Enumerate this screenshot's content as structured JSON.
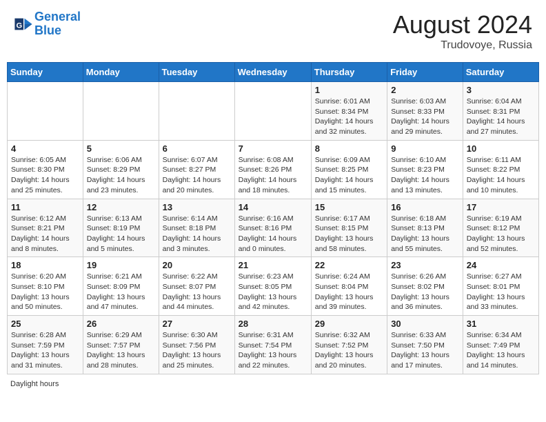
{
  "header": {
    "logo_line1": "General",
    "logo_line2": "Blue",
    "month": "August 2024",
    "location": "Trudovoye, Russia"
  },
  "days_of_week": [
    "Sunday",
    "Monday",
    "Tuesday",
    "Wednesday",
    "Thursday",
    "Friday",
    "Saturday"
  ],
  "weeks": [
    [
      {
        "day": "",
        "info": ""
      },
      {
        "day": "",
        "info": ""
      },
      {
        "day": "",
        "info": ""
      },
      {
        "day": "",
        "info": ""
      },
      {
        "day": "1",
        "info": "Sunrise: 6:01 AM\nSunset: 8:34 PM\nDaylight: 14 hours and 32 minutes."
      },
      {
        "day": "2",
        "info": "Sunrise: 6:03 AM\nSunset: 8:33 PM\nDaylight: 14 hours and 29 minutes."
      },
      {
        "day": "3",
        "info": "Sunrise: 6:04 AM\nSunset: 8:31 PM\nDaylight: 14 hours and 27 minutes."
      }
    ],
    [
      {
        "day": "4",
        "info": "Sunrise: 6:05 AM\nSunset: 8:30 PM\nDaylight: 14 hours and 25 minutes."
      },
      {
        "day": "5",
        "info": "Sunrise: 6:06 AM\nSunset: 8:29 PM\nDaylight: 14 hours and 23 minutes."
      },
      {
        "day": "6",
        "info": "Sunrise: 6:07 AM\nSunset: 8:27 PM\nDaylight: 14 hours and 20 minutes."
      },
      {
        "day": "7",
        "info": "Sunrise: 6:08 AM\nSunset: 8:26 PM\nDaylight: 14 hours and 18 minutes."
      },
      {
        "day": "8",
        "info": "Sunrise: 6:09 AM\nSunset: 8:25 PM\nDaylight: 14 hours and 15 minutes."
      },
      {
        "day": "9",
        "info": "Sunrise: 6:10 AM\nSunset: 8:23 PM\nDaylight: 14 hours and 13 minutes."
      },
      {
        "day": "10",
        "info": "Sunrise: 6:11 AM\nSunset: 8:22 PM\nDaylight: 14 hours and 10 minutes."
      }
    ],
    [
      {
        "day": "11",
        "info": "Sunrise: 6:12 AM\nSunset: 8:21 PM\nDaylight: 14 hours and 8 minutes."
      },
      {
        "day": "12",
        "info": "Sunrise: 6:13 AM\nSunset: 8:19 PM\nDaylight: 14 hours and 5 minutes."
      },
      {
        "day": "13",
        "info": "Sunrise: 6:14 AM\nSunset: 8:18 PM\nDaylight: 14 hours and 3 minutes."
      },
      {
        "day": "14",
        "info": "Sunrise: 6:16 AM\nSunset: 8:16 PM\nDaylight: 14 hours and 0 minutes."
      },
      {
        "day": "15",
        "info": "Sunrise: 6:17 AM\nSunset: 8:15 PM\nDaylight: 13 hours and 58 minutes."
      },
      {
        "day": "16",
        "info": "Sunrise: 6:18 AM\nSunset: 8:13 PM\nDaylight: 13 hours and 55 minutes."
      },
      {
        "day": "17",
        "info": "Sunrise: 6:19 AM\nSunset: 8:12 PM\nDaylight: 13 hours and 52 minutes."
      }
    ],
    [
      {
        "day": "18",
        "info": "Sunrise: 6:20 AM\nSunset: 8:10 PM\nDaylight: 13 hours and 50 minutes."
      },
      {
        "day": "19",
        "info": "Sunrise: 6:21 AM\nSunset: 8:09 PM\nDaylight: 13 hours and 47 minutes."
      },
      {
        "day": "20",
        "info": "Sunrise: 6:22 AM\nSunset: 8:07 PM\nDaylight: 13 hours and 44 minutes."
      },
      {
        "day": "21",
        "info": "Sunrise: 6:23 AM\nSunset: 8:05 PM\nDaylight: 13 hours and 42 minutes."
      },
      {
        "day": "22",
        "info": "Sunrise: 6:24 AM\nSunset: 8:04 PM\nDaylight: 13 hours and 39 minutes."
      },
      {
        "day": "23",
        "info": "Sunrise: 6:26 AM\nSunset: 8:02 PM\nDaylight: 13 hours and 36 minutes."
      },
      {
        "day": "24",
        "info": "Sunrise: 6:27 AM\nSunset: 8:01 PM\nDaylight: 13 hours and 33 minutes."
      }
    ],
    [
      {
        "day": "25",
        "info": "Sunrise: 6:28 AM\nSunset: 7:59 PM\nDaylight: 13 hours and 31 minutes."
      },
      {
        "day": "26",
        "info": "Sunrise: 6:29 AM\nSunset: 7:57 PM\nDaylight: 13 hours and 28 minutes."
      },
      {
        "day": "27",
        "info": "Sunrise: 6:30 AM\nSunset: 7:56 PM\nDaylight: 13 hours and 25 minutes."
      },
      {
        "day": "28",
        "info": "Sunrise: 6:31 AM\nSunset: 7:54 PM\nDaylight: 13 hours and 22 minutes."
      },
      {
        "day": "29",
        "info": "Sunrise: 6:32 AM\nSunset: 7:52 PM\nDaylight: 13 hours and 20 minutes."
      },
      {
        "day": "30",
        "info": "Sunrise: 6:33 AM\nSunset: 7:50 PM\nDaylight: 13 hours and 17 minutes."
      },
      {
        "day": "31",
        "info": "Sunrise: 6:34 AM\nSunset: 7:49 PM\nDaylight: 13 hours and 14 minutes."
      }
    ]
  ],
  "footer": {
    "label": "Daylight hours"
  }
}
